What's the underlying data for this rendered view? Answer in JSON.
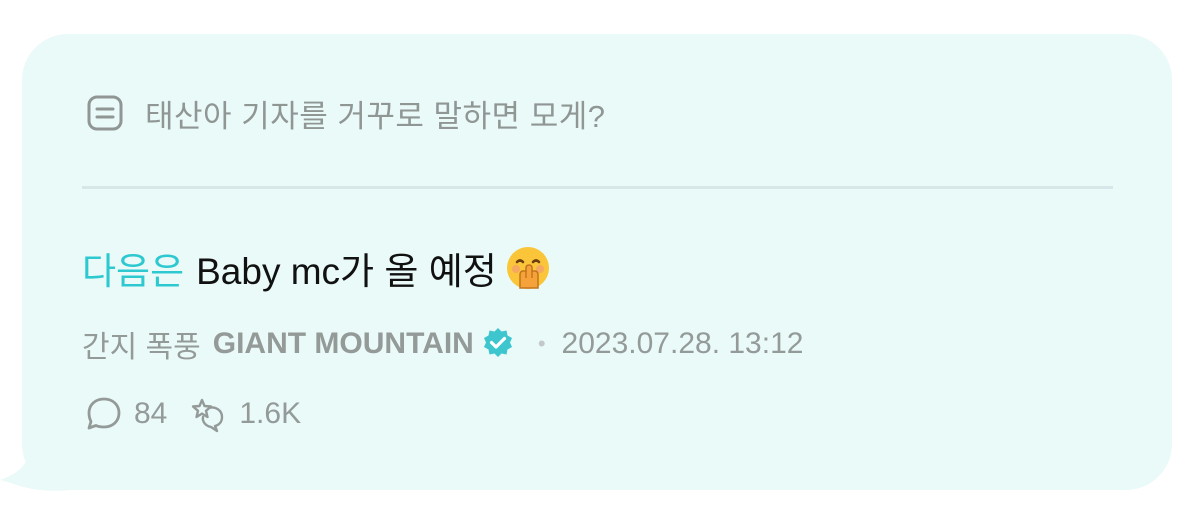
{
  "question": {
    "icon": "question-list-icon",
    "text": "태산아 기자를 거꾸로 말하면 모게?"
  },
  "answer": {
    "highlight": "다음은",
    "text": "Baby mc가 올 예정",
    "emoji": "hand-over-mouth-emoji"
  },
  "meta": {
    "author_prefix": "간지 폭풍",
    "author_name": "GIANT MOUNTAIN",
    "verified_icon": "verified-badge-icon",
    "separator": "•",
    "timestamp": "2023.07.28. 13:12"
  },
  "stats": {
    "comments_icon": "comment-bubble-icon",
    "comments": "84",
    "likes_icon": "sparkle-reaction-icon",
    "likes": "1.6K"
  },
  "colors": {
    "bubble": "#e9faf8",
    "accent": "#2ec9d0",
    "verified": "#3ec6cf",
    "muted_text": "#939a98"
  }
}
